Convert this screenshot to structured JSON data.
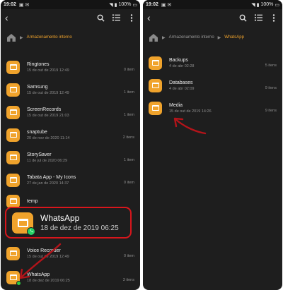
{
  "left": {
    "status": {
      "time": "19:02",
      "battery": "100%"
    },
    "breadcrumb": {
      "root": "Armazenamento interno"
    },
    "items": [
      {
        "name": "Ringtones",
        "date": "15 de out de 2019 12:49",
        "count": "0 item"
      },
      {
        "name": "Samsung",
        "date": "15 de out de 2019 12:49",
        "count": "1 item"
      },
      {
        "name": "ScreenRecords",
        "date": "15 de out de 2019 21:03",
        "count": "1 item"
      },
      {
        "name": "snaptube",
        "date": "20 de nov de 2020 11:14",
        "count": "2 itens"
      },
      {
        "name": "StorySaver",
        "date": "11 de jul de 2020 06:29",
        "count": "1 item"
      },
      {
        "name": "Tabata App - My Icons",
        "date": "27 de jan de 2020 14:37",
        "count": "0 item"
      },
      {
        "name": "temp",
        "date": "",
        "count": ""
      },
      {
        "name": "Voice Recorder",
        "date": "15 de out de 2019 12:49",
        "count": "0 item"
      },
      {
        "name": "WhatsApp",
        "date": "18 de dez de 2019 06:25",
        "count": "3 itens"
      }
    ],
    "highlight": {
      "name": "WhatsApp",
      "date": "18 de dez de 2019 06:25"
    }
  },
  "right": {
    "status": {
      "time": "19:02",
      "battery": "100%"
    },
    "breadcrumb": {
      "root": "Armazenamento interno",
      "current": "WhatsApp"
    },
    "items": [
      {
        "name": "Backups",
        "date": "4 de abr 02:28",
        "count": "5 itens"
      },
      {
        "name": "Databases",
        "date": "4 de abr 02:09",
        "count": "9 itens"
      },
      {
        "name": "Media",
        "date": "15 de out de 2019 14:26",
        "count": "9 itens"
      }
    ]
  },
  "colors": {
    "accent": "#f0a32c",
    "highlight": "#d8161c",
    "whatsapp": "#25d366"
  }
}
